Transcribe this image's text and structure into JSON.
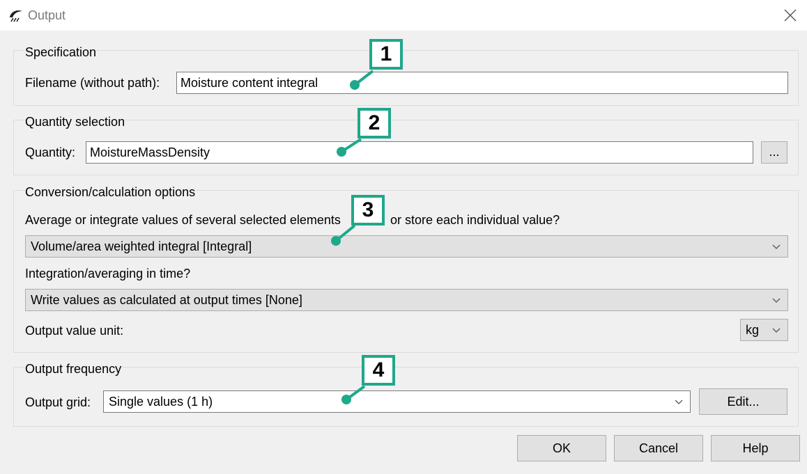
{
  "window": {
    "title": "Output"
  },
  "specification": {
    "title": "Specification",
    "filename_label": "Filename (without path):",
    "filename_value": "Moisture content integral"
  },
  "quantity": {
    "title": "Quantity selection",
    "label": "Quantity:",
    "value": "MoistureMassDensity",
    "browse_label": "..."
  },
  "conversion": {
    "title": "Conversion/calculation options",
    "average_question_left": "Average or integrate values of several selected elements",
    "average_question_right": "or store each individual value?",
    "average_selected": "Volume/area weighted integral [Integral]",
    "time_question": "Integration/averaging in time?",
    "time_selected": "Write values as calculated at output times [None]",
    "unit_label": "Output value unit:",
    "unit_selected": "kg"
  },
  "frequency": {
    "title": "Output frequency",
    "grid_label": "Output grid:",
    "grid_selected": "Single values (1 h)",
    "edit_label": "Edit..."
  },
  "buttons": {
    "ok": "OK",
    "cancel": "Cancel",
    "help": "Help"
  },
  "callouts": [
    "1",
    "2",
    "3",
    "4"
  ],
  "colors": {
    "callout_border": "#1fa88a",
    "combo_bg": "#e1e1e1"
  }
}
